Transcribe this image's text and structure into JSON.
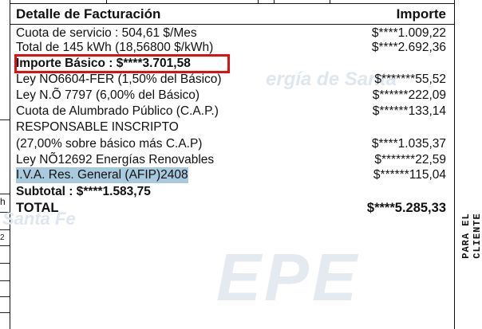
{
  "side_marks": [
    "h",
    "2"
  ],
  "header": {
    "title": "Detalle de Facturación",
    "amount_title": "Importe"
  },
  "rows": [
    {
      "desc": "Cuota de servicio :  504,61 $/Mes",
      "amount": "$****1.009,22"
    },
    {
      "desc": "Total de 145 kWh (18,56800 $/kWh)",
      "amount": "$****2.692,36"
    },
    {
      "desc": "Importe Básico   :    $****3.701,58",
      "amount": ""
    },
    {
      "desc": "Ley NO6604-FER (1,50% del Básico)",
      "amount": "$*******55,52"
    },
    {
      "desc": "Ley N.Õ 7797 (6,00% del Básico)",
      "amount": "$******222,09"
    },
    {
      "desc": "Cuota de Alumbrado Público (C.A.P.)",
      "amount": "$******133,14"
    },
    {
      "desc": "RESPONSABLE INSCRIPTO",
      "amount": ""
    },
    {
      "desc": "(27,00% sobre básico más C.A.P)",
      "amount": "$****1.035,37"
    },
    {
      "desc": "Ley NÕ12692 Energías Renovables",
      "amount": "$*******22,59"
    },
    {
      "desc": "I.V.A. Res. General (AFIP)2408",
      "amount": "$******115,04"
    },
    {
      "desc": "Subtotal :          $****1.583,75",
      "amount": ""
    },
    {
      "desc": "TOTAL",
      "amount": "$****5.285,33"
    }
  ],
  "watermark": {
    "line1": "ergía de Santa",
    "line2": "Santa Fe",
    "logo": "EPE"
  },
  "side_label": "PARA EL CLIENTE"
}
